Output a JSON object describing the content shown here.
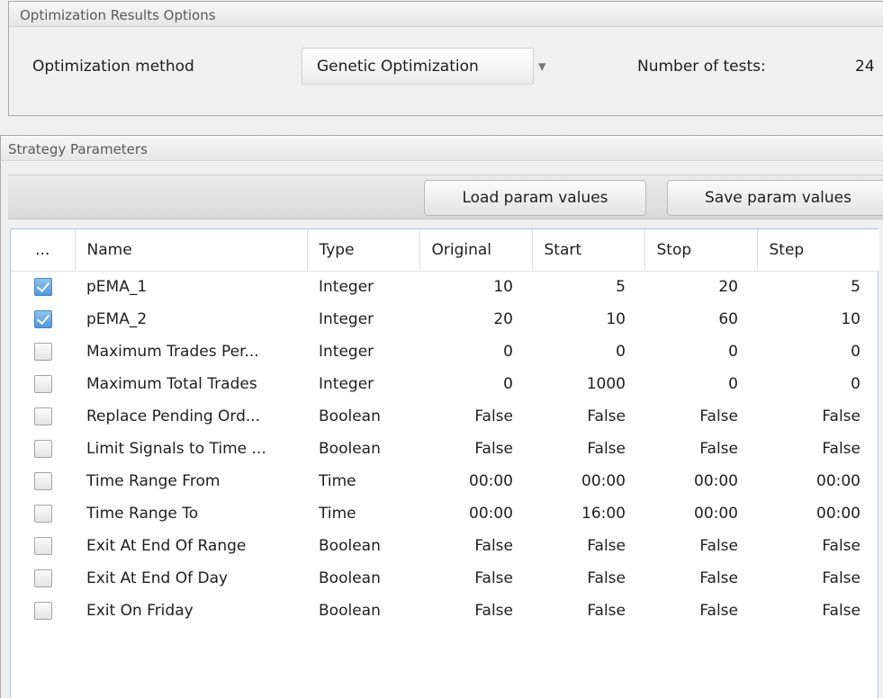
{
  "optimization": {
    "group_title": "Optimization Results Options",
    "method_label": "Optimization method",
    "method_value": "Genetic Optimization",
    "tests_label": "Number of tests:",
    "tests_value": "24"
  },
  "strategy": {
    "group_title": "Strategy Parameters",
    "load_button": "Load param values",
    "save_button": "Save param values"
  },
  "table": {
    "headers": [
      "...",
      "Name",
      "Type",
      "Original",
      "Start",
      "Stop",
      "Step"
    ],
    "rows": [
      {
        "checked": true,
        "name": "pEMA_1",
        "type": "Integer",
        "original": "10",
        "start": "5",
        "stop": "20",
        "step": "5"
      },
      {
        "checked": true,
        "name": "pEMA_2",
        "type": "Integer",
        "original": "20",
        "start": "10",
        "stop": "60",
        "step": "10"
      },
      {
        "checked": false,
        "name": "Maximum Trades Per...",
        "type": "Integer",
        "original": "0",
        "start": "0",
        "stop": "0",
        "step": "0"
      },
      {
        "checked": false,
        "name": "Maximum Total Trades",
        "type": "Integer",
        "original": "0",
        "start": "1000",
        "stop": "0",
        "step": "0"
      },
      {
        "checked": false,
        "name": "Replace Pending Ord...",
        "type": "Boolean",
        "original": "False",
        "start": "False",
        "stop": "False",
        "step": "False"
      },
      {
        "checked": false,
        "name": "Limit Signals to Time ...",
        "type": "Boolean",
        "original": "False",
        "start": "False",
        "stop": "False",
        "step": "False"
      },
      {
        "checked": false,
        "name": "Time Range From",
        "type": "Time",
        "original": "00:00",
        "start": "00:00",
        "stop": "00:00",
        "step": "00:00"
      },
      {
        "checked": false,
        "name": "Time Range To",
        "type": "Time",
        "original": "00:00",
        "start": "16:00",
        "stop": "00:00",
        "step": "00:00"
      },
      {
        "checked": false,
        "name": "Exit At End Of Range",
        "type": "Boolean",
        "original": "False",
        "start": "False",
        "stop": "False",
        "step": "False"
      },
      {
        "checked": false,
        "name": "Exit At End Of Day",
        "type": "Boolean",
        "original": "False",
        "start": "False",
        "stop": "False",
        "step": "False"
      },
      {
        "checked": false,
        "name": "Exit On Friday",
        "type": "Boolean",
        "original": "False",
        "start": "False",
        "stop": "False",
        "step": "False"
      }
    ]
  }
}
